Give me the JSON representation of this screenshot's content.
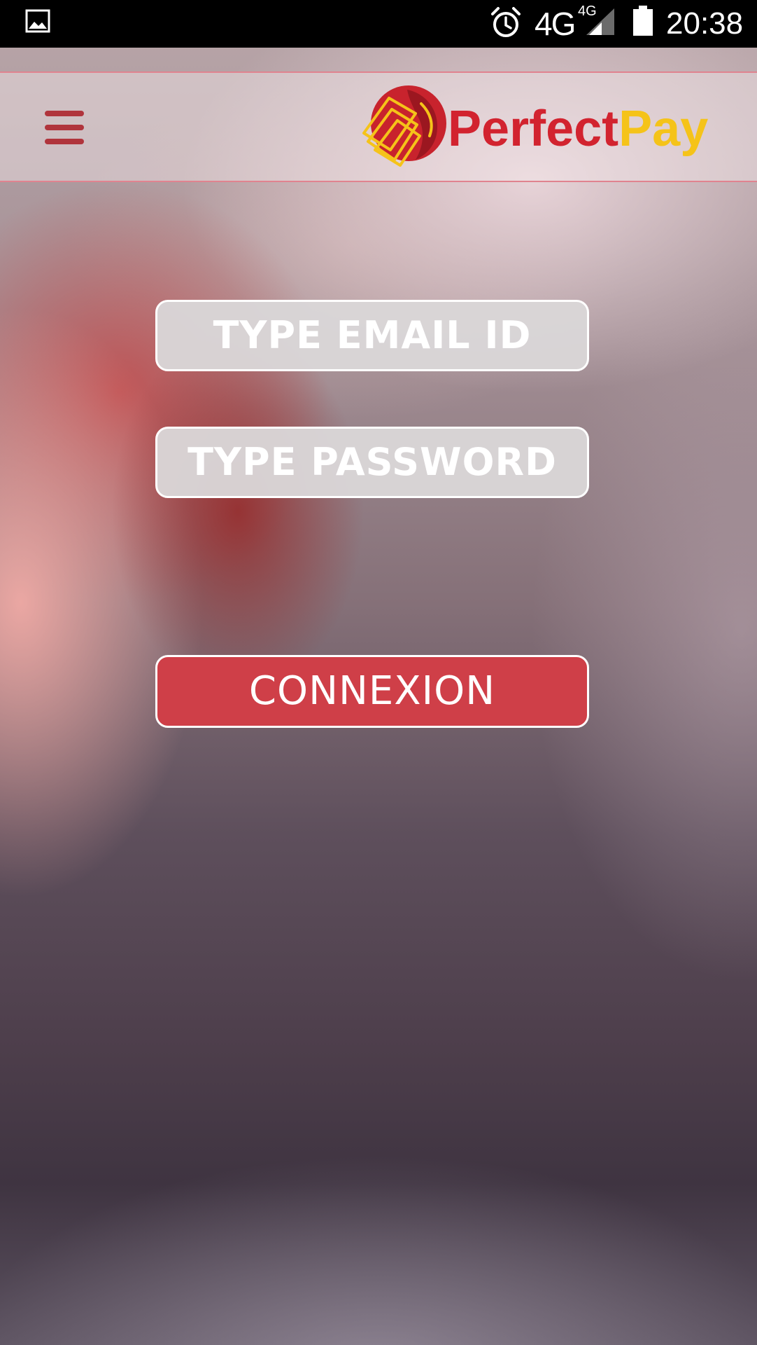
{
  "status_bar": {
    "network": "4G",
    "network_secondary": "4G",
    "time": "20:38",
    "icons": [
      "gallery-icon",
      "alarm-icon",
      "signal-icon",
      "battery-icon"
    ]
  },
  "app_bar": {
    "menu_icon": "hamburger-menu-icon",
    "logo": {
      "word1": "Perfect",
      "word2": "Pay",
      "color_primary": "#d2232f",
      "color_secondary": "#f5c319"
    }
  },
  "login_form": {
    "email_placeholder": "TYPE EMAIL ID",
    "password_placeholder": "TYPE PASSWORD",
    "submit_label": "CONNEXION",
    "submit_color": "#cf3f48"
  }
}
